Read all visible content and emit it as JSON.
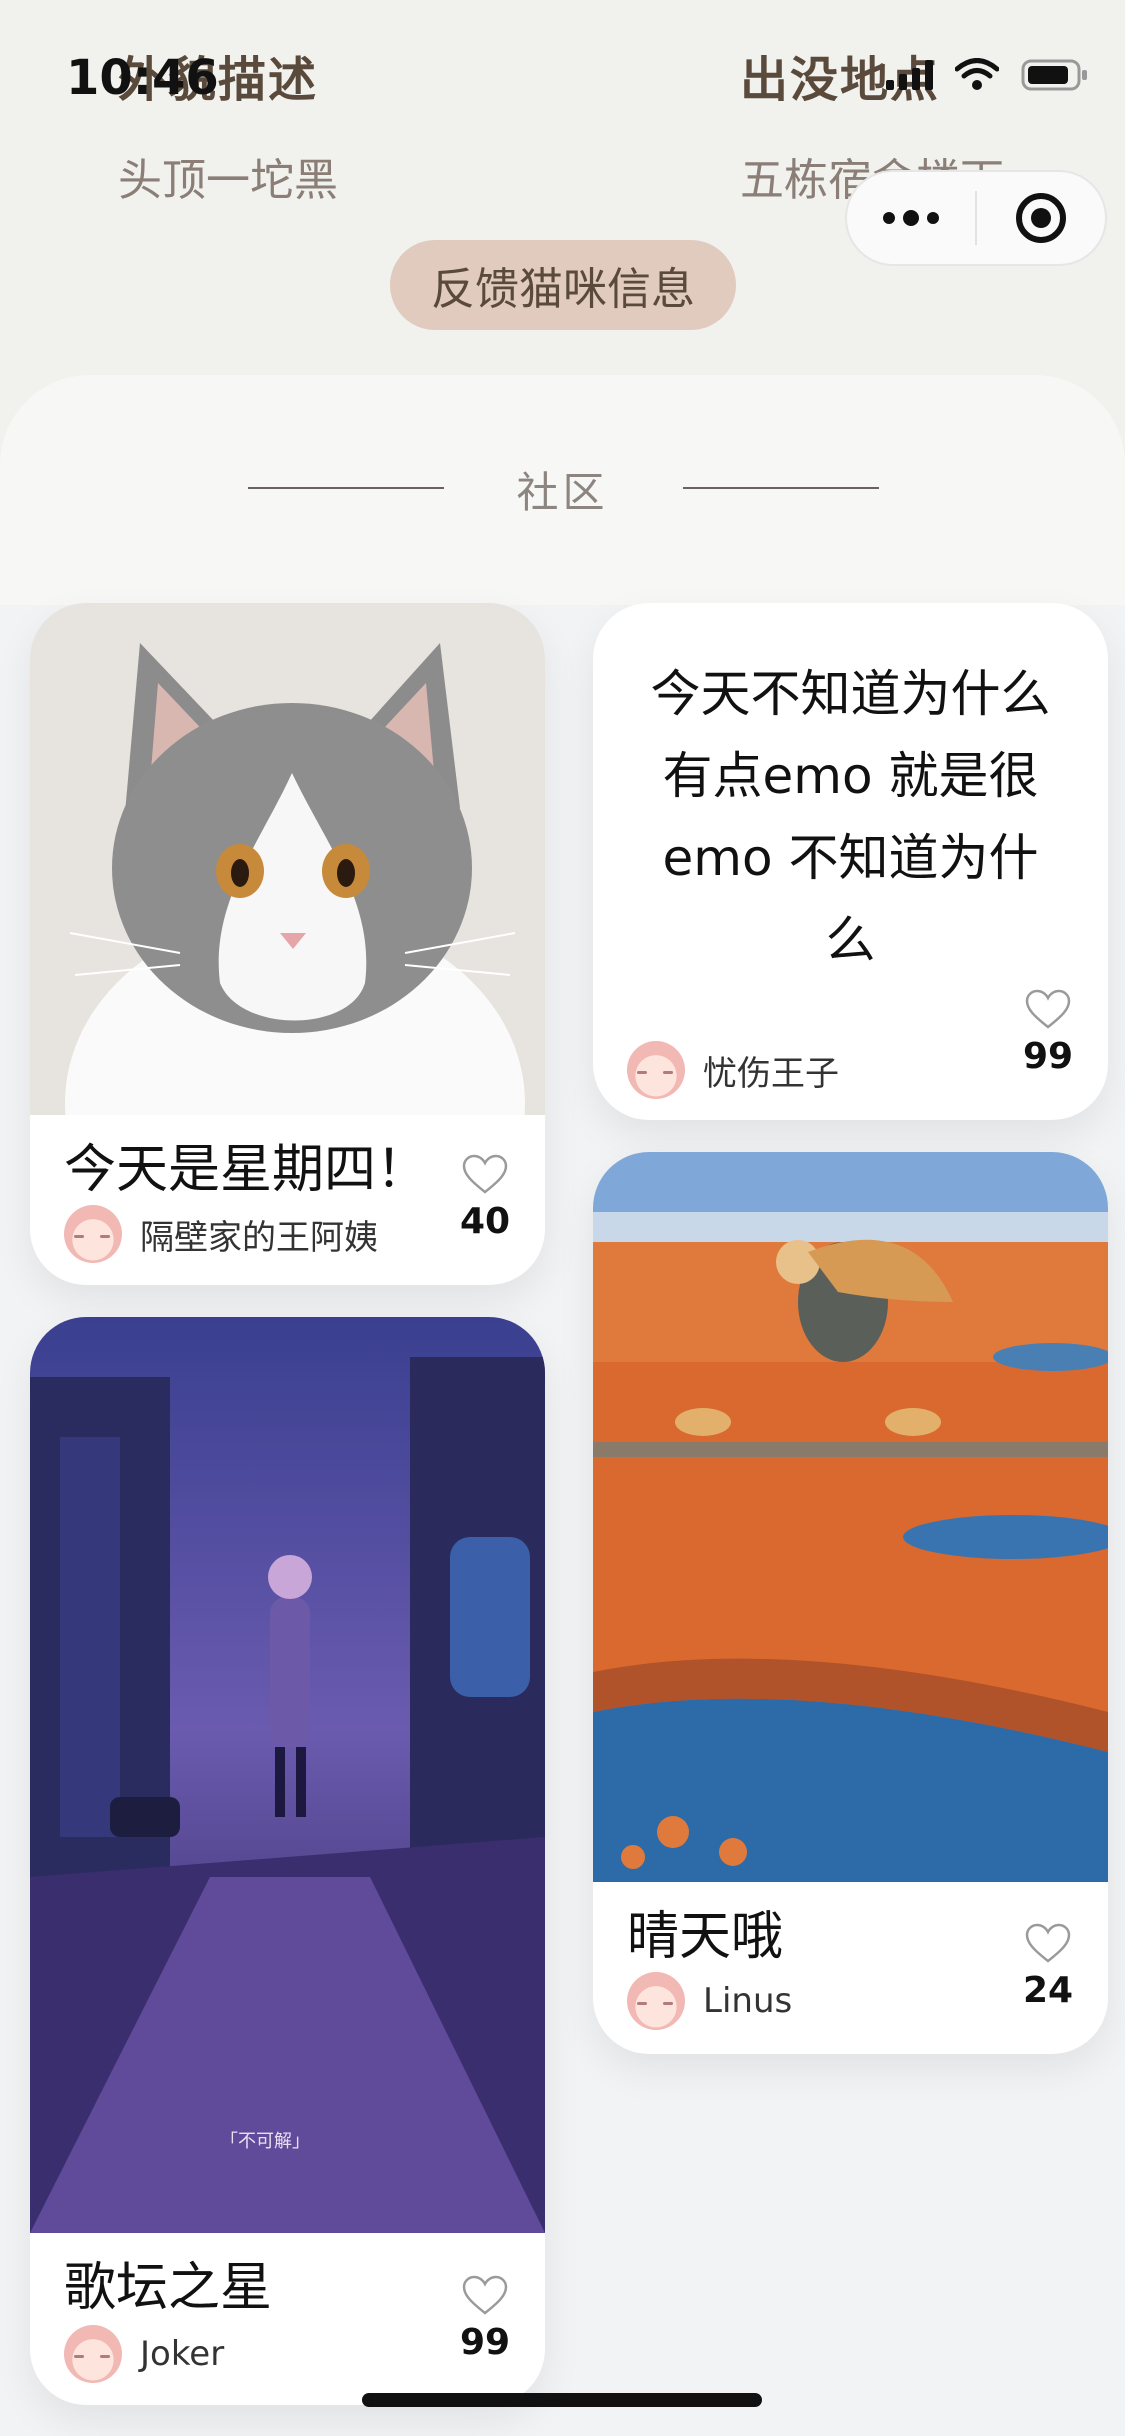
{
  "status_bar": {
    "time": "10:46"
  },
  "cat_info": {
    "appearance_label": "外貌描述",
    "appearance_value": "头顶一坨黑",
    "location_label": "出没地点",
    "location_value": "五栋宿舍楼下"
  },
  "feedback_button": "反馈猫咪信息",
  "community": {
    "title": "社区"
  },
  "posts": [
    {
      "title": "今天是星期四！",
      "author": "隔壁家的王阿姨",
      "likes": "40"
    },
    {
      "text": "今天不知道为什么有点emo 就是很emo 不知道为什么",
      "author": "忧伤王子",
      "likes": "99"
    },
    {
      "title": "歌坛之星",
      "author": "Joker",
      "likes": "99"
    },
    {
      "title": "晴天哦",
      "author": "Linus",
      "likes": "24"
    }
  ],
  "image_caption": "「不可解」",
  "icons": {
    "capsule_more": "more-dots-icon",
    "capsule_close": "target-icon",
    "like": "heart-outline-icon",
    "signal": "cellular-signal-icon",
    "wifi": "wifi-icon",
    "battery": "battery-icon"
  },
  "colors": {
    "accent_button": "#e1cbbf",
    "label_brown": "#5a4a3c",
    "page_bg": "#f2f3f5"
  }
}
